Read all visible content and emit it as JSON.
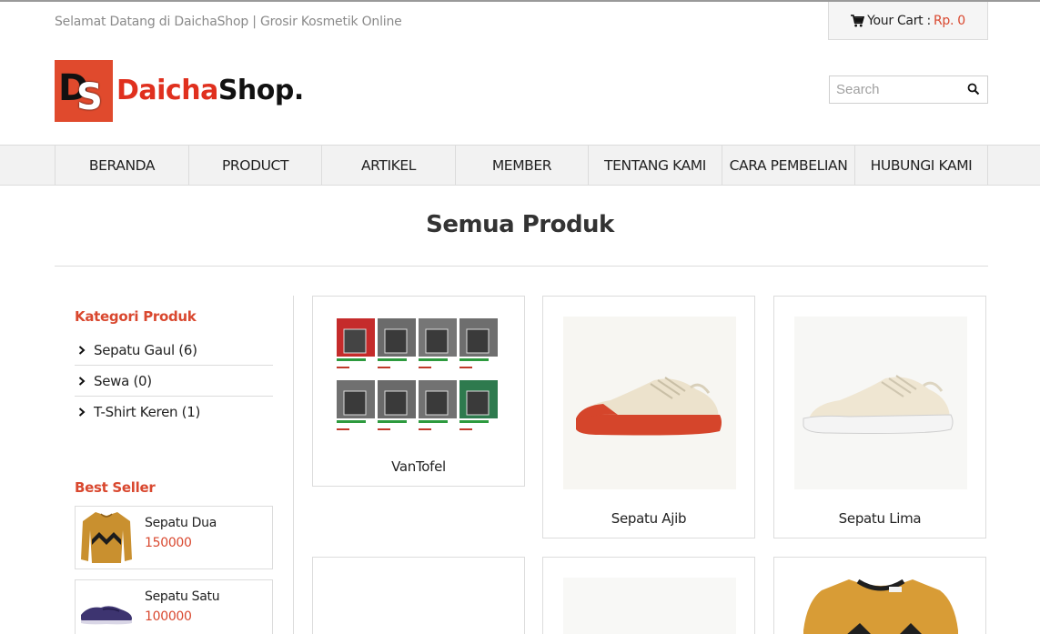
{
  "topbar": {
    "welcome": "Selamat Datang di DaichaShop | Grosir Kosmetik Online",
    "cart_label": "Your Cart :",
    "cart_amount": "Rp. 0"
  },
  "logo": {
    "mark_d": "D",
    "mark_s": "S",
    "brand_red": "Daicha",
    "brand_dark": "Shop."
  },
  "search": {
    "placeholder": "Search"
  },
  "nav": {
    "items": [
      {
        "label": "BERANDA"
      },
      {
        "label": "PRODUCT"
      },
      {
        "label": "ARTIKEL"
      },
      {
        "label": "MEMBER"
      },
      {
        "label": "TENTANG KAMI"
      },
      {
        "label": "CARA PEMBELIAN"
      },
      {
        "label": "HUBUNGI KAMI"
      }
    ]
  },
  "page": {
    "title": "Semua Produk"
  },
  "sidebar": {
    "categories_title": "Kategori Produk",
    "categories": [
      {
        "label": "Sepatu Gaul (6)"
      },
      {
        "label": "Sewa (0)"
      },
      {
        "label": "T-Shirt Keren (1)"
      }
    ],
    "best_seller_title": "Best Seller",
    "best_sellers": [
      {
        "name": "Sepatu Dua",
        "price": "150000",
        "icon": "sweater-thumbnail"
      },
      {
        "name": "Sepatu Satu",
        "price": "100000",
        "icon": "loafer-shoe-thumbnail"
      }
    ]
  },
  "products": [
    {
      "name": "VanTofel",
      "icon": "sd-card-grid-image"
    },
    {
      "name": "Sepatu Ajib",
      "icon": "sneaker-red-sole-image"
    },
    {
      "name": "Sepatu Lima",
      "icon": "sneaker-white-sole-image"
    },
    {
      "name": "",
      "icon": "empty-image"
    },
    {
      "name": "",
      "icon": "blank-image"
    },
    {
      "name": "",
      "icon": "sweater-image"
    }
  ],
  "colors": {
    "accent": "#d9482f",
    "brand_red": "#e0301e",
    "nav_bg": "#f2f2f2",
    "border": "#dcdcdc"
  }
}
